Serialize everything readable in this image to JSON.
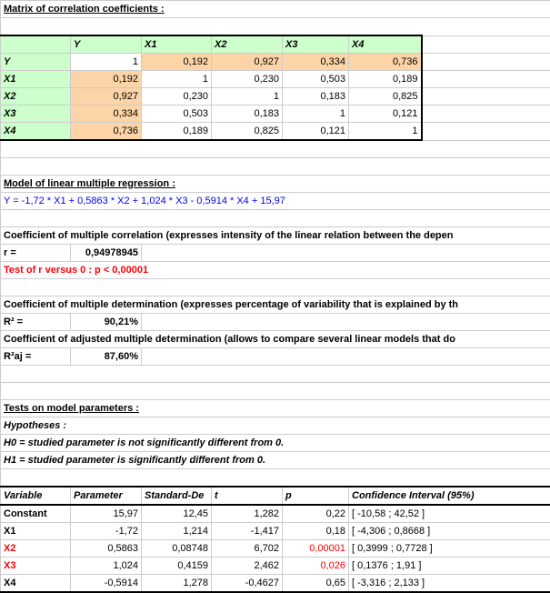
{
  "title": "Matrix of correlation coefficients :",
  "vars": [
    "Y",
    "X1",
    "X2",
    "X3",
    "X4"
  ],
  "corr": [
    [
      "1",
      "0,192",
      "0,927",
      "0,334",
      "0,736"
    ],
    [
      "0,192",
      "1",
      "0,230",
      "0,503",
      "0,189"
    ],
    [
      "0,927",
      "0,230",
      "1",
      "0,183",
      "0,825"
    ],
    [
      "0,334",
      "0,503",
      "0,183",
      "1",
      "0,121"
    ],
    [
      "0,736",
      "0,189",
      "0,825",
      "0,121",
      "1"
    ]
  ],
  "model_title": "Model of linear multiple regression :",
  "model_eq": "Y = -1,72 * X1 + 0,5863 * X2 + 1,024 * X3 - 0,5914 * X4 + 15,97",
  "coef_mult": "Coefficient of multiple correlation (expresses intensity of the linear relation between the depen",
  "r_label": "r =",
  "r_value": "0,94978945",
  "test_r": "Test of r versus 0 : p < 0,00001",
  "coef_det": "Coefficient of multiple determination (expresses percentage of variability that is explained by th",
  "r2_label": "R² =",
  "r2_value": "90,21%",
  "coef_adj": "Coefficient of adjusted multiple determination (allows to compare several linear models that do",
  "r2aj_label": "R²aj =",
  "r2aj_value": "87,60%",
  "tests_title": "Tests on model parameters :",
  "hyp": "Hypotheses :",
  "h0": "H0 = studied parameter is not significantly different from 0.",
  "h1": "H1 = studied parameter is significantly different from 0.",
  "cols": {
    "var": "Variable",
    "param": "Parameter",
    "sd": "Standard-De",
    "t": "t",
    "p": "p",
    "ci": "Confidence Interval (95%)"
  },
  "params": [
    {
      "v": "Constant",
      "p": "15,97",
      "sd": "12,45",
      "t": "1,282",
      "pv": "0,22",
      "ci": "[ -10,58 ; 42,52 ]",
      "red": false
    },
    {
      "v": "X1",
      "p": "-1,72",
      "sd": "1,214",
      "t": "-1,417",
      "pv": "0,18",
      "ci": "[ -4,306 ; 0,8668 ]",
      "red": false
    },
    {
      "v": "X2",
      "p": "0,5863",
      "sd": "0,08748",
      "t": "6,702",
      "pv": "0,00001",
      "ci": "[ 0,3999 ; 0,7728 ]",
      "red": true
    },
    {
      "v": "X3",
      "p": "1,024",
      "sd": "0,4159",
      "t": "2,462",
      "pv": "0,026",
      "ci": "[ 0,1376 ; 1,91 ]",
      "red": true
    },
    {
      "v": "X4",
      "p": "-0,5914",
      "sd": "1,278",
      "t": "-0,4627",
      "pv": "0,65",
      "ci": "[ -3,316 ; 2,133 ]",
      "red": false
    }
  ]
}
